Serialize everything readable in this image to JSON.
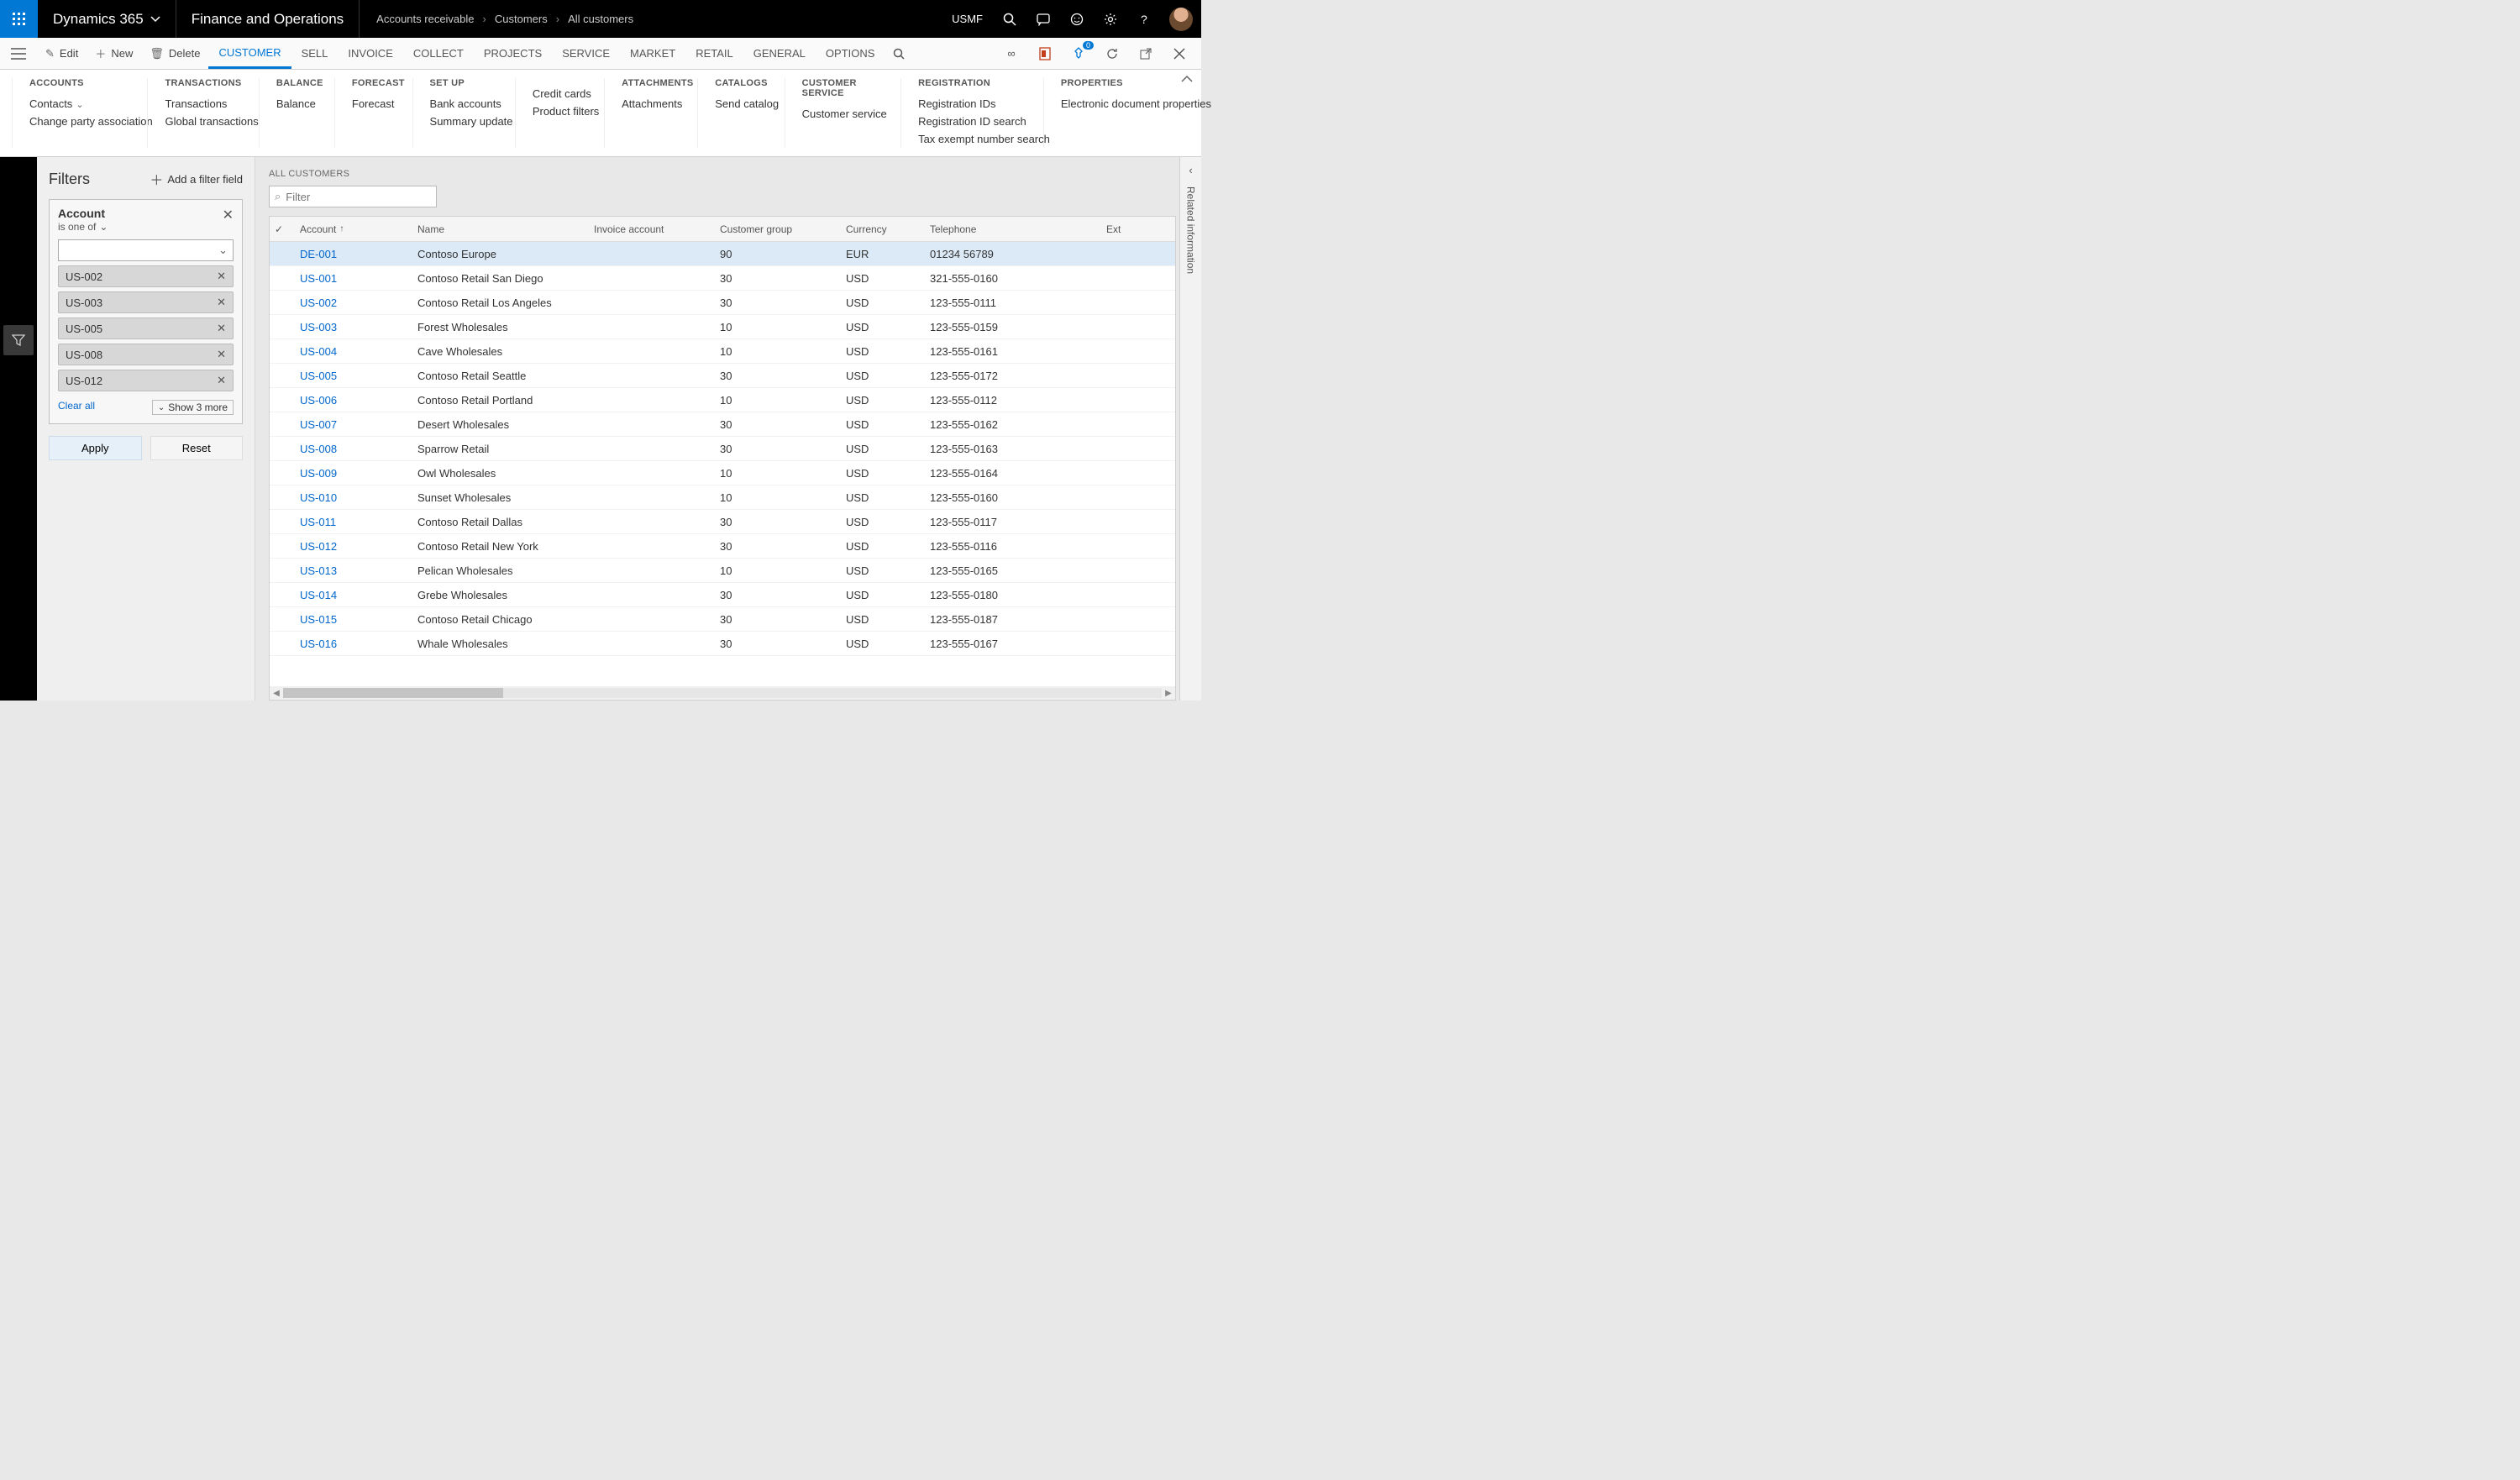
{
  "top": {
    "brand": "Dynamics 365",
    "module": "Finance and Operations",
    "breadcrumbs": [
      "Accounts receivable",
      "Customers",
      "All customers"
    ],
    "company": "USMF"
  },
  "actions": {
    "edit": "Edit",
    "new": "New",
    "delete": "Delete",
    "tabs": [
      "CUSTOMER",
      "SELL",
      "INVOICE",
      "COLLECT",
      "PROJECTS",
      "SERVICE",
      "MARKET",
      "RETAIL",
      "GENERAL",
      "OPTIONS"
    ],
    "active_tab": 0,
    "notification_count": "0"
  },
  "ribbon": [
    {
      "title": "ACCOUNTS",
      "items": [
        "Contacts",
        "Change party association"
      ],
      "dropdown": [
        true,
        false
      ]
    },
    {
      "title": "TRANSACTIONS",
      "items": [
        "Transactions",
        "Global transactions"
      ]
    },
    {
      "title": "BALANCE",
      "items": [
        "Balance"
      ]
    },
    {
      "title": "FORECAST",
      "items": [
        "Forecast"
      ]
    },
    {
      "title": "SET UP",
      "items": [
        "Bank accounts",
        "Summary update"
      ]
    },
    {
      "title": "",
      "items": [
        "Credit cards",
        "Product filters"
      ]
    },
    {
      "title": "ATTACHMENTS",
      "items": [
        "Attachments"
      ]
    },
    {
      "title": "CATALOGS",
      "items": [
        "Send catalog"
      ]
    },
    {
      "title": "CUSTOMER SERVICE",
      "items": [
        "Customer service"
      ]
    },
    {
      "title": "REGISTRATION",
      "items": [
        "Registration IDs",
        "Registration ID search",
        "Tax exempt number search"
      ]
    },
    {
      "title": "PROPERTIES",
      "items": [
        "Electronic document properties"
      ]
    }
  ],
  "filters": {
    "heading": "Filters",
    "add": "Add a filter field",
    "card": {
      "field": "Account",
      "op": "is one of",
      "chips": [
        "US-002",
        "US-003",
        "US-005",
        "US-008",
        "US-012"
      ],
      "clear": "Clear all",
      "showmore": "Show 3 more"
    },
    "apply": "Apply",
    "reset": "Reset"
  },
  "grid": {
    "title": "ALL CUSTOMERS",
    "filter_placeholder": "Filter",
    "columns": [
      "Account",
      "Name",
      "Invoice account",
      "Customer group",
      "Currency",
      "Telephone",
      "Ext"
    ],
    "sort_col": 0,
    "rows": [
      {
        "account": "DE-001",
        "name": "Contoso Europe",
        "invoice": "",
        "group": "90",
        "currency": "EUR",
        "tel": "01234 56789",
        "selected": true
      },
      {
        "account": "US-001",
        "name": "Contoso Retail San Diego",
        "invoice": "",
        "group": "30",
        "currency": "USD",
        "tel": "321-555-0160"
      },
      {
        "account": "US-002",
        "name": "Contoso Retail Los Angeles",
        "invoice": "",
        "group": "30",
        "currency": "USD",
        "tel": "123-555-0111"
      },
      {
        "account": "US-003",
        "name": "Forest Wholesales",
        "invoice": "",
        "group": "10",
        "currency": "USD",
        "tel": "123-555-0159"
      },
      {
        "account": "US-004",
        "name": "Cave Wholesales",
        "invoice": "",
        "group": "10",
        "currency": "USD",
        "tel": "123-555-0161"
      },
      {
        "account": "US-005",
        "name": "Contoso Retail Seattle",
        "invoice": "",
        "group": "30",
        "currency": "USD",
        "tel": "123-555-0172"
      },
      {
        "account": "US-006",
        "name": "Contoso Retail Portland",
        "invoice": "",
        "group": "10",
        "currency": "USD",
        "tel": "123-555-0112"
      },
      {
        "account": "US-007",
        "name": "Desert Wholesales",
        "invoice": "",
        "group": "30",
        "currency": "USD",
        "tel": "123-555-0162"
      },
      {
        "account": "US-008",
        "name": "Sparrow Retail",
        "invoice": "",
        "group": "30",
        "currency": "USD",
        "tel": "123-555-0163"
      },
      {
        "account": "US-009",
        "name": "Owl Wholesales",
        "invoice": "",
        "group": "10",
        "currency": "USD",
        "tel": "123-555-0164"
      },
      {
        "account": "US-010",
        "name": "Sunset Wholesales",
        "invoice": "",
        "group": "10",
        "currency": "USD",
        "tel": "123-555-0160"
      },
      {
        "account": "US-011",
        "name": "Contoso Retail Dallas",
        "invoice": "",
        "group": "30",
        "currency": "USD",
        "tel": "123-555-0117"
      },
      {
        "account": "US-012",
        "name": "Contoso Retail New York",
        "invoice": "",
        "group": "30",
        "currency": "USD",
        "tel": "123-555-0116"
      },
      {
        "account": "US-013",
        "name": "Pelican Wholesales",
        "invoice": "",
        "group": "10",
        "currency": "USD",
        "tel": "123-555-0165"
      },
      {
        "account": "US-014",
        "name": "Grebe Wholesales",
        "invoice": "",
        "group": "30",
        "currency": "USD",
        "tel": "123-555-0180"
      },
      {
        "account": "US-015",
        "name": "Contoso Retail Chicago",
        "invoice": "",
        "group": "30",
        "currency": "USD",
        "tel": "123-555-0187"
      },
      {
        "account": "US-016",
        "name": "Whale Wholesales",
        "invoice": "",
        "group": "30",
        "currency": "USD",
        "tel": "123-555-0167"
      }
    ]
  },
  "related": "Related information"
}
